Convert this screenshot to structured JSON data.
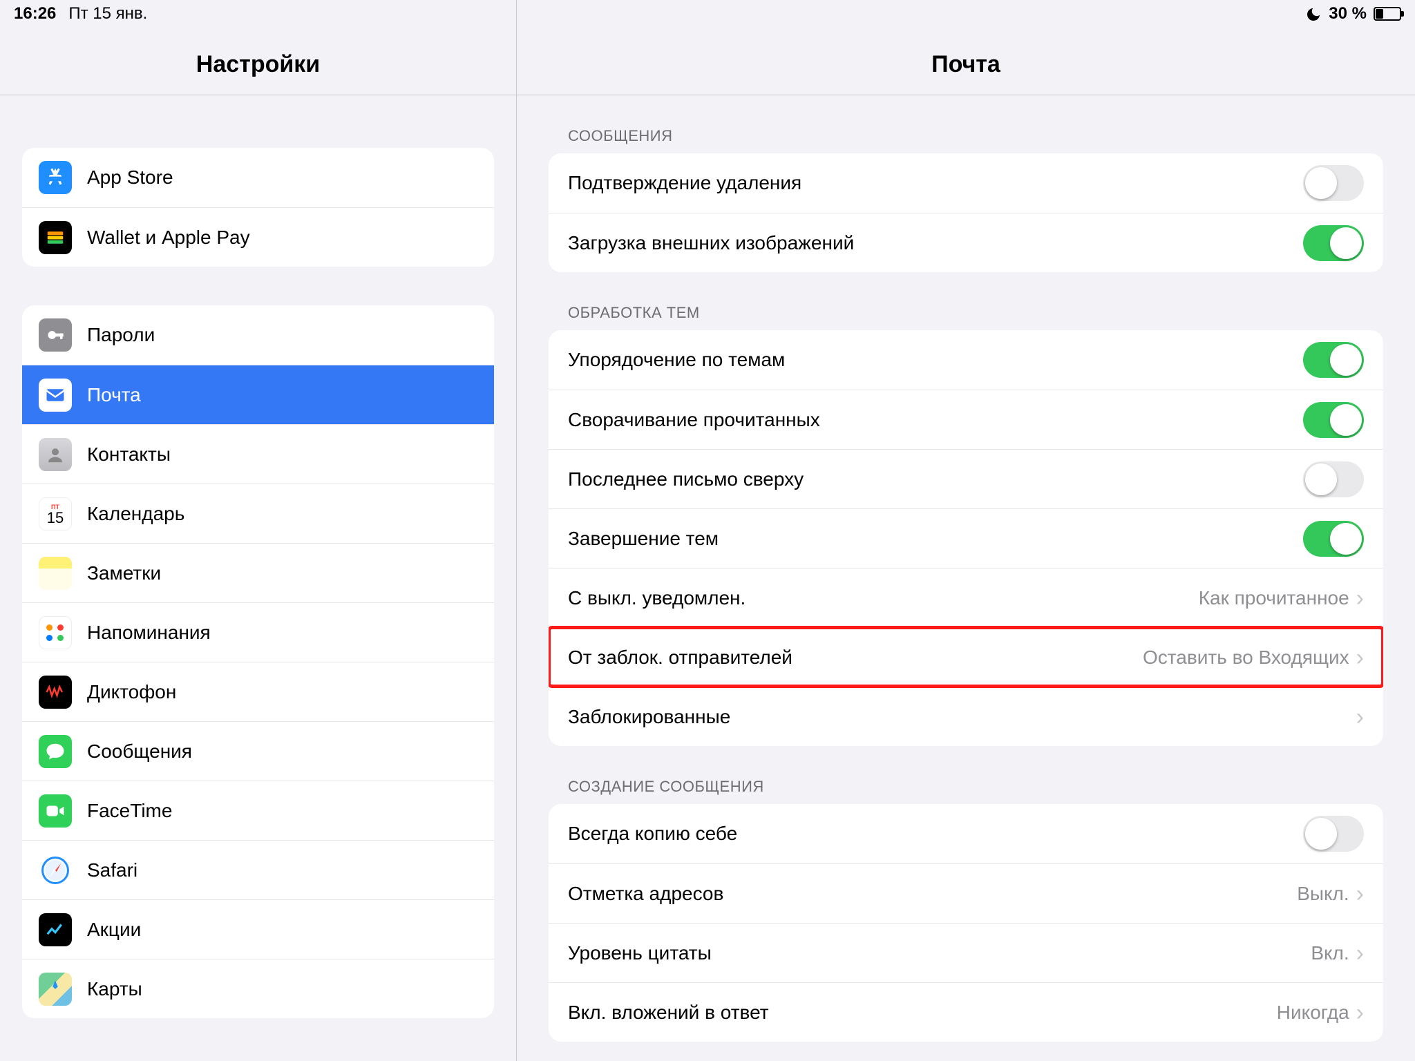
{
  "statusbar": {
    "time": "16:26",
    "date": "Пт 15 янв.",
    "battery": "30 %"
  },
  "sidebar": {
    "title": "Настройки",
    "group1": [
      {
        "label": "App Store",
        "icon": "appstore"
      },
      {
        "label": "Wallet и Apple Pay",
        "icon": "wallet"
      }
    ],
    "group2": [
      {
        "label": "Пароли",
        "icon": "passwords"
      },
      {
        "label": "Почта",
        "icon": "mail",
        "selected": true
      },
      {
        "label": "Контакты",
        "icon": "contacts"
      },
      {
        "label": "Календарь",
        "icon": "calendar"
      },
      {
        "label": "Заметки",
        "icon": "notes"
      },
      {
        "label": "Напоминания",
        "icon": "reminders"
      },
      {
        "label": "Диктофон",
        "icon": "voice"
      },
      {
        "label": "Сообщения",
        "icon": "messages"
      },
      {
        "label": "FaceTime",
        "icon": "facetime"
      },
      {
        "label": "Safari",
        "icon": "safari"
      },
      {
        "label": "Акции",
        "icon": "stocks"
      },
      {
        "label": "Карты",
        "icon": "maps"
      }
    ]
  },
  "detail": {
    "title": "Почта",
    "sections": {
      "messages": {
        "header": "СООБЩЕНИЯ",
        "rows": [
          {
            "label": "Подтверждение удаления",
            "type": "toggle",
            "on": false
          },
          {
            "label": "Загрузка внешних изображений",
            "type": "toggle",
            "on": true
          }
        ]
      },
      "threads": {
        "header": "ОБРАБОТКА ТЕМ",
        "rows": [
          {
            "label": "Упорядочение по темам",
            "type": "toggle",
            "on": true
          },
          {
            "label": "Сворачивание прочитанных",
            "type": "toggle",
            "on": true
          },
          {
            "label": "Последнее письмо сверху",
            "type": "toggle",
            "on": false
          },
          {
            "label": "Завершение тем",
            "type": "toggle",
            "on": true
          },
          {
            "label": "С выкл. уведомлен.",
            "type": "nav",
            "value": "Как прочитанное"
          },
          {
            "label": "От заблок. отправителей",
            "type": "nav",
            "value": "Оставить во Входящих",
            "highlight": true
          },
          {
            "label": "Заблокированные",
            "type": "nav",
            "value": ""
          }
        ]
      },
      "compose": {
        "header": "СОЗДАНИЕ СООБЩЕНИЯ",
        "rows": [
          {
            "label": "Всегда копию себе",
            "type": "toggle",
            "on": false
          },
          {
            "label": "Отметка адресов",
            "type": "nav",
            "value": "Выкл."
          },
          {
            "label": "Уровень цитаты",
            "type": "nav",
            "value": "Вкл."
          },
          {
            "label": "Вкл. вложений в ответ",
            "type": "nav",
            "value": "Никогда"
          }
        ]
      }
    }
  },
  "colors": {
    "accent": "#3478f6",
    "green": "#34c759",
    "gray": "#8e8e93",
    "highlight": "#ff1a1a"
  }
}
